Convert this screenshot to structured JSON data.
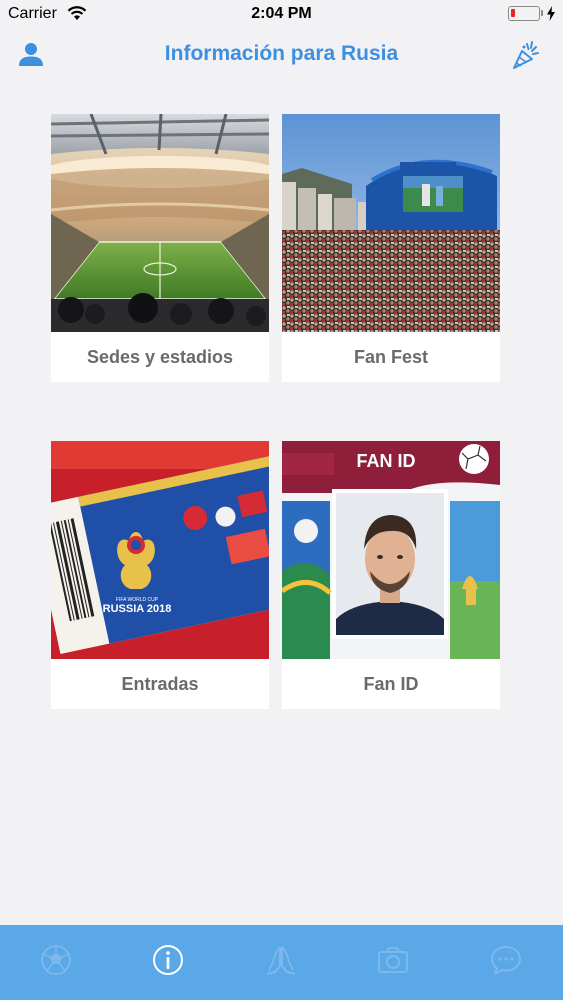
{
  "status_bar": {
    "carrier": "Carrier",
    "time": "2:04 PM",
    "battery_level": 0.15,
    "battery_color": "#e8232a"
  },
  "nav": {
    "title": "Información para Rusia",
    "left_icon": "user-icon",
    "right_icon": "brand-logo-icon",
    "accent": "#3d8fe0"
  },
  "cards": [
    {
      "label": "Sedes y estadios",
      "image": "stadium-photo"
    },
    {
      "label": "Fan Fest",
      "image": "fan-fest-crowd-photo"
    },
    {
      "label": "Entradas",
      "image": "tickets-photo",
      "image_text": "FIFA WORLD CUP RUSSIA 2018"
    },
    {
      "label": "Fan ID",
      "image": "fan-id-card-photo",
      "image_text": "FAN ID"
    }
  ],
  "tab_bar": {
    "background": "#5aa8e8",
    "active_index": 1,
    "tabs": [
      {
        "icon": "soccer-ball-icon"
      },
      {
        "icon": "info-icon"
      },
      {
        "icon": "praying-hands-icon"
      },
      {
        "icon": "camera-icon"
      },
      {
        "icon": "chat-bubble-icon"
      }
    ]
  }
}
